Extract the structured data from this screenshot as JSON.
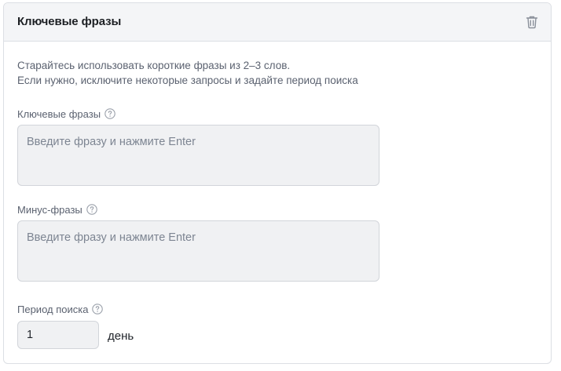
{
  "card": {
    "title": "Ключевые фразы",
    "delete_icon": "trash-icon",
    "description": {
      "line1": "Старайтесь использовать короткие фразы из 2–3 слов.",
      "line2": "Если нужно, исключите некоторые запросы и задайте период поиска"
    }
  },
  "fields": {
    "keywords": {
      "label": "Ключевые фразы",
      "help_icon": "question-circle-icon",
      "placeholder": "Введите фразу и нажмите Enter",
      "value": ""
    },
    "minus": {
      "label": "Минус-фразы",
      "help_icon": "question-circle-icon",
      "placeholder": "Введите фразу и нажмите Enter",
      "value": ""
    },
    "period": {
      "label": "Период поиска",
      "help_icon": "question-circle-icon",
      "value": "1",
      "unit": "день"
    }
  },
  "colors": {
    "header_bg": "#f4f5f7",
    "input_bg": "#f0f1f3",
    "border": "#dcdfe4",
    "muted_text": "#5b6270"
  }
}
